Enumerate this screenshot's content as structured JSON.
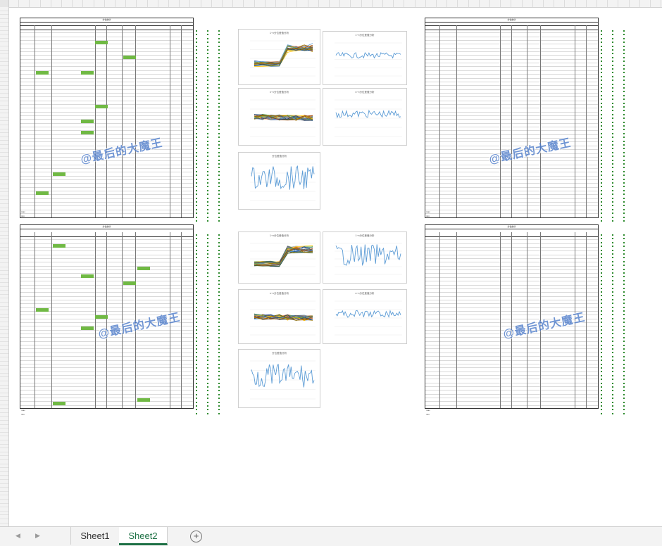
{
  "tabs": [
    {
      "label": "Sheet1",
      "active": false
    },
    {
      "label": "Sheet2",
      "active": true
    }
  ],
  "add_sheet_symbol": "+",
  "nav_prev_icon": "◀",
  "nav_next_icon": "▶",
  "watermark": "@最后的大魔王",
  "accent": "#1e7145",
  "highlight_color": "#70b944",
  "line_color": "#5b9bd5",
  "chart_titles": {
    "top_row": "1~n分位差值分析",
    "mid_row": "n~n分位差值分析",
    "bottom_row": "分位差值分析"
  },
  "block_titles": {
    "top": "分位统计",
    "bottom": "分位统计"
  },
  "summary_labels": [
    "max",
    "min"
  ]
}
